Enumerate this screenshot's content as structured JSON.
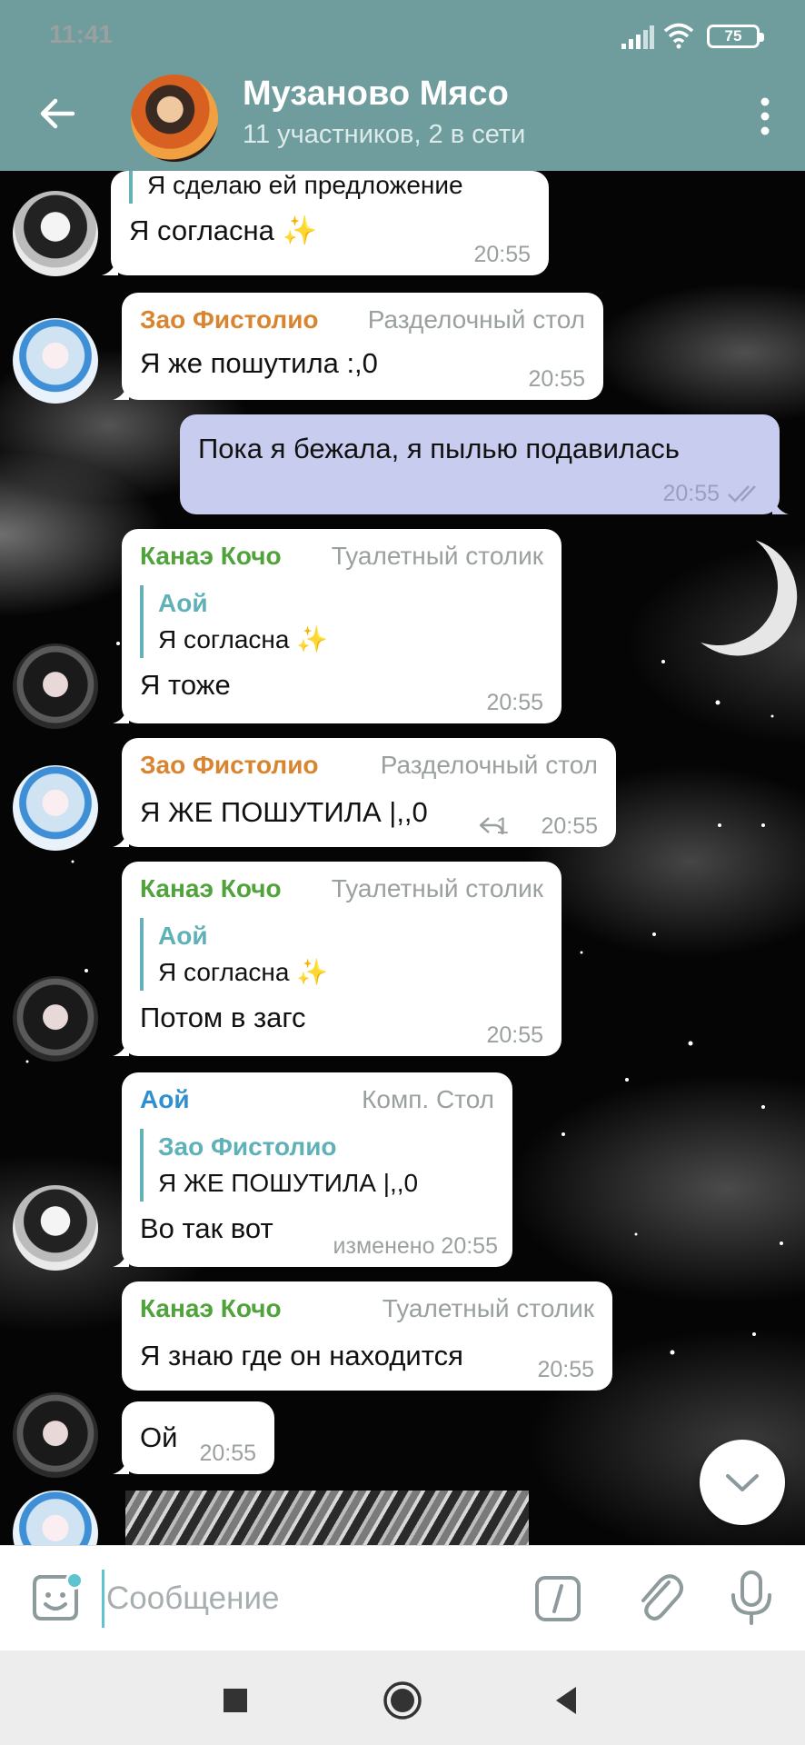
{
  "status_bar": {
    "time": "11:41",
    "battery": "75"
  },
  "header": {
    "title": "Музаново Мясо",
    "subtitle": "11 участников, 2 в сети"
  },
  "messages": [
    {
      "reply_text": "Я сделаю ей предложение",
      "text": "Я согласна ✨",
      "time": "20:55"
    },
    {
      "sender": "Зао Фистолио",
      "role": "Разделочный стол",
      "text": "Я же пошутила :,0",
      "time": "20:55"
    },
    {
      "text": "Пока я бежала, я пылью подавилась",
      "time": "20:55"
    },
    {
      "sender": "Канаэ Кочо",
      "role": "Туалетный столик",
      "reply_name": "Аой",
      "reply_text": "Я согласна ✨",
      "text": "Я тоже",
      "time": "20:55"
    },
    {
      "sender": "Зао Фистолио",
      "role": "Разделочный стол",
      "text": "Я ЖЕ ПОШУТИЛА |,,0",
      "reply_count": "1",
      "time": "20:55"
    },
    {
      "sender": "Канаэ Кочо",
      "role": "Туалетный столик",
      "reply_name": "Аой",
      "reply_text": "Я согласна ✨",
      "text": "Потом в загс",
      "time": "20:55"
    },
    {
      "sender": "Аой",
      "role": "Комп. Стол",
      "reply_name": "Зао Фистолио",
      "reply_text": "Я ЖЕ ПОШУТИЛА |,,0",
      "text": "Во так вот",
      "time": "изменено 20:55"
    },
    {
      "sender": "Канаэ Кочо",
      "role": "Туалетный столик",
      "text": "Я знаю где он находится",
      "time": "20:55"
    },
    {
      "text": "Ой",
      "time": "20:55"
    }
  ],
  "input": {
    "placeholder": "Сообщение"
  },
  "colors": {
    "header_bg": "#6f9c9c",
    "outgoing_bubble": "#c8ccee",
    "sender_zao": "#d9852f",
    "sender_kanae": "#4fa33a",
    "sender_aoi": "#2f8fd0",
    "reply_accent": "#5fb1b8"
  },
  "icons": [
    "back-arrow-icon",
    "more-vert-icon",
    "signal-icon",
    "wifi-icon",
    "battery-icon",
    "sticker-icon",
    "bot-command-icon",
    "paperclip-icon",
    "microphone-icon",
    "reply-icon",
    "double-check-icon",
    "chevron-down-icon",
    "nav-square-icon",
    "nav-circle-icon",
    "nav-back-icon"
  ]
}
